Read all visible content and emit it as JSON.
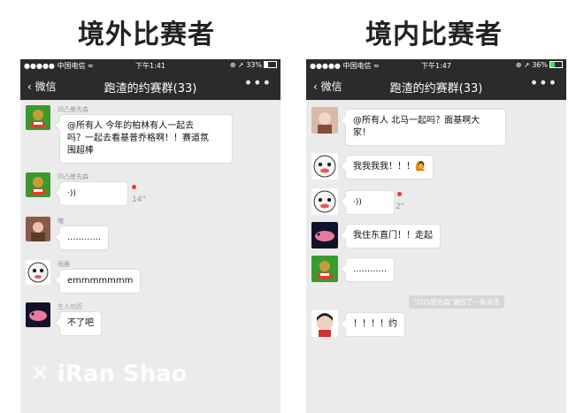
{
  "left": {
    "heading": "境外比赛者",
    "status": {
      "carrier": "●●●●● 中国电信 ≈",
      "time": "下午1:41",
      "right": "⊕ ➚ 33%"
    },
    "nav": {
      "back": "微信",
      "title": "跑渣的约赛群(33)",
      "more": "•••"
    },
    "messages": [
      {
        "sender": "凹凸曼先森",
        "text1": "@所有人 今年的柏林有人一起去",
        "text2": "吗？一起去看基普乔格啊！！赛道氛",
        "text3": "围超棒"
      },
      {
        "sender": "凹凸曼先森",
        "voice_len": "14\""
      },
      {
        "sender": "曦",
        "text": "............"
      },
      {
        "sender": "雨晨",
        "text": "emmmmmmm"
      },
      {
        "sender": "生人勿近",
        "text": "不了吧"
      }
    ]
  },
  "right": {
    "heading": "境内比赛者",
    "status": {
      "carrier": "●●●●● 中国电信 ≈",
      "time": "下午1:47",
      "right": "⊕ ➚ 36%"
    },
    "nav": {
      "back": "微信",
      "title": "跑渣的约赛群(33)",
      "more": "•••"
    },
    "messages": [
      {
        "text1": "@所有人 北马一起吗？面基啊大",
        "text2": "家！"
      },
      {
        "text": "我我我我！！！🙋"
      },
      {
        "voice_len": "2\""
      },
      {
        "text": "我住东直门！！走起"
      },
      {
        "text": "............"
      },
      {
        "text": "！！！！约"
      }
    ],
    "system_note": "\"凹凸曼先森\"撤回了一条消息"
  },
  "watermark": "iRan Shao",
  "colors": {
    "bar": "#2b2b2b",
    "chat_bg": "#ebebeb",
    "unread_dot": "#f43530"
  }
}
